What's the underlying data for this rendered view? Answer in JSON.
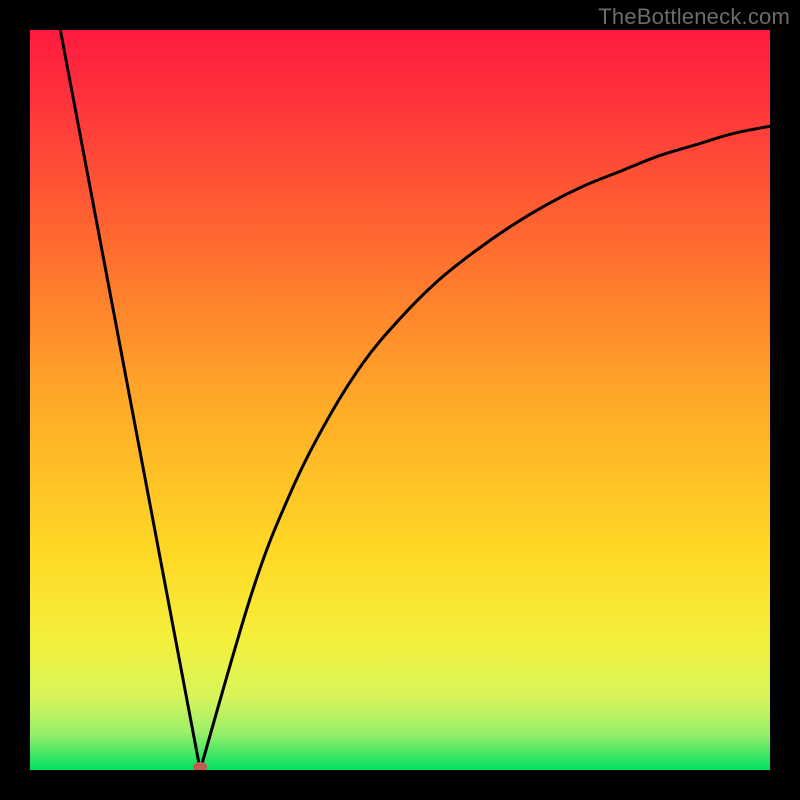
{
  "attribution": "TheBottleneck.com",
  "chart_data": {
    "type": "line",
    "title": "",
    "xlabel": "",
    "ylabel": "",
    "xlim": [
      0,
      100
    ],
    "ylim": [
      0,
      100
    ],
    "grid": false,
    "legend": false,
    "background_gradient": {
      "top": "#ff1a3f",
      "mid": "#ffa928",
      "bottom": "#00e060"
    },
    "marker": {
      "x": 23,
      "y": 0,
      "color": "#c45a54",
      "shape": "oval"
    },
    "left_segment": {
      "description": "straight descending line from top-left to minimum",
      "x": [
        4.1,
        23
      ],
      "y": [
        100,
        0
      ]
    },
    "right_segment": {
      "description": "concave curve rising from minimum toward upper-right, asymptotically leveling",
      "x": [
        23,
        30,
        35,
        40,
        45,
        50,
        55,
        60,
        65,
        70,
        75,
        80,
        85,
        90,
        95,
        100
      ],
      "y": [
        0,
        24,
        37,
        47,
        55,
        61,
        66,
        70,
        73.5,
        76.5,
        79,
        81,
        83,
        84.5,
        86,
        87
      ]
    }
  }
}
